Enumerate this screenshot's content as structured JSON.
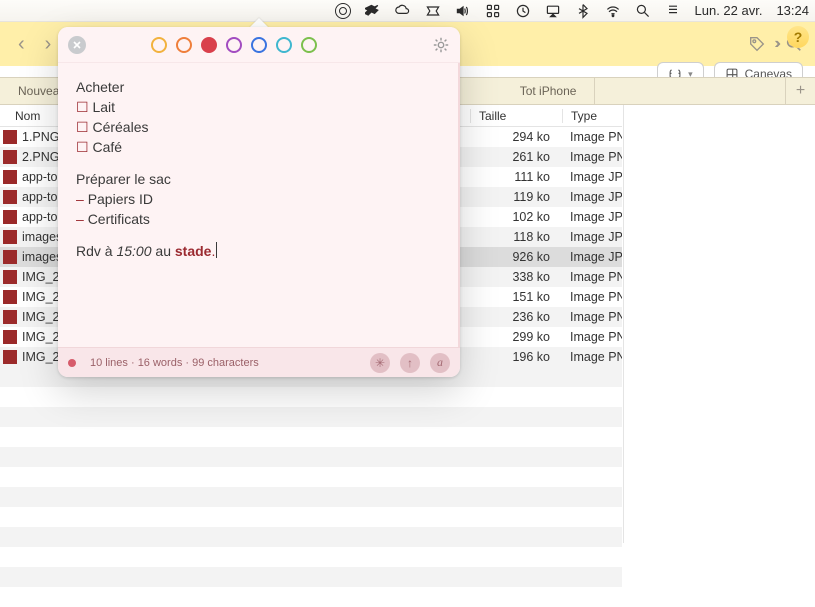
{
  "menubar": {
    "date_text": "Lun. 22 avr.",
    "time_text": "13:24"
  },
  "finder": {
    "tab1": "Nouveau do",
    "tab2": "Tot iPhone",
    "col_name": "Nom",
    "col_size": "Taille",
    "col_type": "Type",
    "files": [
      {
        "name": "1.PNG",
        "size": "294 ko",
        "type": "Image PN"
      },
      {
        "name": "2.PNG",
        "size": "261 ko",
        "type": "Image PN"
      },
      {
        "name": "app-to",
        "size": "111 ko",
        "type": "Image JP"
      },
      {
        "name": "app-to",
        "size": "119 ko",
        "type": "Image JP"
      },
      {
        "name": "app-to",
        "size": "102 ko",
        "type": "Image JP"
      },
      {
        "name": "images",
        "size": "118 ko",
        "type": "Image JP"
      },
      {
        "name": "images",
        "size": "926 ko",
        "type": "Image JP",
        "selected": true
      },
      {
        "name": "IMG_2",
        "size": "338 ko",
        "type": "Image PN"
      },
      {
        "name": "IMG_2",
        "size": "151 ko",
        "type": "Image PN"
      },
      {
        "name": "IMG_2",
        "size": "236 ko",
        "type": "Image PN"
      },
      {
        "name": "IMG_2",
        "size": "299 ko",
        "type": "Image PN"
      },
      {
        "name": "IMG_2",
        "size": "196 ko",
        "type": "Image PN"
      }
    ]
  },
  "pills": {
    "canevas": "Canevas"
  },
  "note": {
    "colors": [
      "#f2b23e",
      "#ef7f3b",
      "#d9404c",
      "#a24cc0",
      "#3a74e0",
      "#3fb7cf",
      "#7cc04d"
    ],
    "h1": "Acheter",
    "c1": "Lait",
    "c2": "Céréales",
    "c3": "Café",
    "h2": "Préparer le sac",
    "d1": "Papiers ID",
    "d2": "Certificats",
    "l_pre": "Rdv à ",
    "l_time": "15:00",
    "l_mid": " au ",
    "l_place": "stade",
    "l_dot": ".",
    "stats": "10 lines · 16 words · 99 characters"
  }
}
